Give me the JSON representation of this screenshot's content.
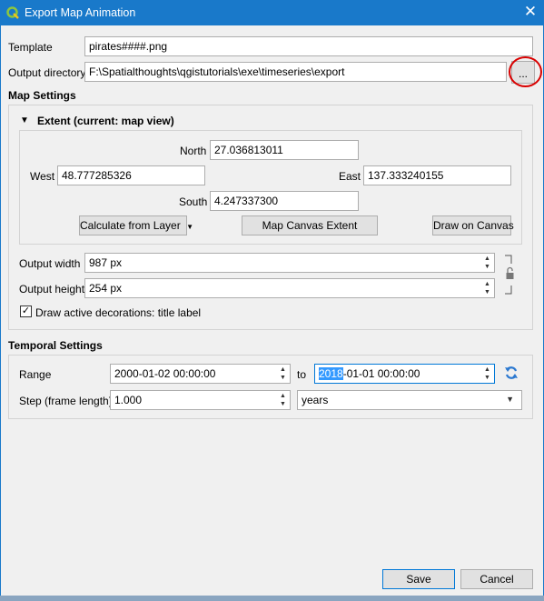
{
  "window": {
    "title": "Export Map Animation",
    "close_glyph": "✕"
  },
  "template": {
    "label": "Template",
    "value": "pirates####.png"
  },
  "output_directory": {
    "label": "Output directory",
    "value": "F:\\Spatialthoughts\\qgistutorials\\exe\\timeseries\\export",
    "browse_label": "..."
  },
  "map_settings": {
    "title": "Map Settings",
    "extent": {
      "title": "Extent (current: map view)",
      "north_label": "North",
      "north_value": "27.036813011",
      "west_label": "West",
      "west_value": "48.777285326",
      "east_label": "East",
      "east_value": "137.333240155",
      "south_label": "South",
      "south_value": "4.247337300",
      "calc_layer_label": "Calculate from Layer",
      "map_canvas_label": "Map Canvas Extent",
      "draw_canvas_label": "Draw on Canvas"
    },
    "output_width_label": "Output width",
    "output_width_value": "987 px",
    "output_height_label": "Output height",
    "output_height_value": "254 px",
    "decorations_label": "Draw active decorations: title label",
    "decorations_checked": "✓"
  },
  "temporal_settings": {
    "title": "Temporal Settings",
    "range_label": "Range",
    "range_start": "2000-01-02 00:00:00",
    "to_label": "to",
    "range_end_year": "2018",
    "range_end_rest": "-01-01 00:00:00",
    "step_label": "Step (frame length)",
    "step_value": "1.000",
    "step_unit": "years"
  },
  "buttons": {
    "save": "Save",
    "cancel": "Cancel"
  },
  "colors": {
    "titlebar": "#1979ca",
    "highlight": "#d90000",
    "selection": "#3399ff"
  },
  "icons": [
    "qgis-icon",
    "close-icon",
    "collapse-arrow-icon",
    "lock-icon",
    "refresh-icon",
    "spin-arrows-icon",
    "chevron-down-icon"
  ]
}
